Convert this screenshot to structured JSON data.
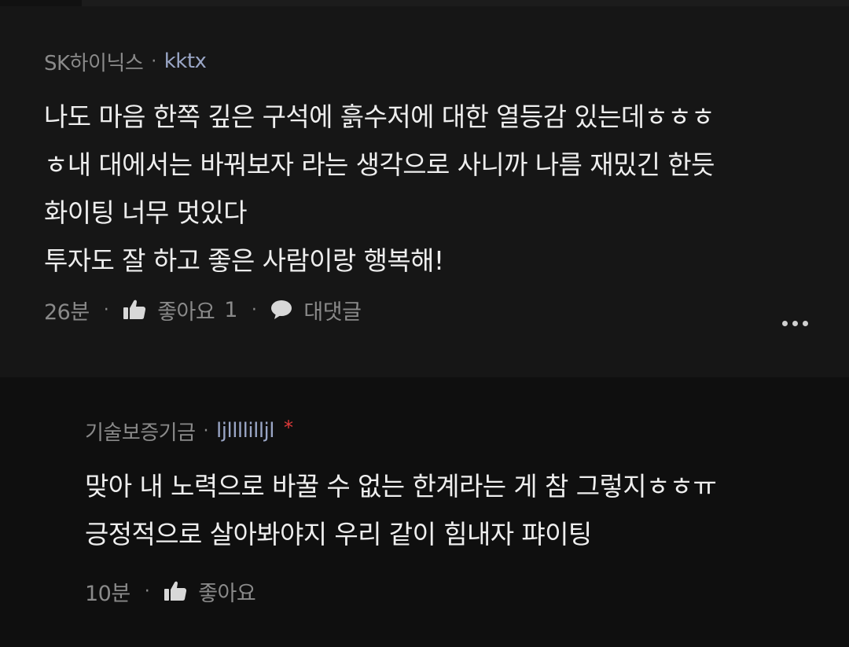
{
  "comments": [
    {
      "company": "SK하이닉스",
      "separator": "·",
      "author": "kktx",
      "lines": [
        "나도 마음 한쪽 깊은 구석에 흙수저에 대한 열등감 있는데ㅎㅎㅎ",
        "ㅎ내 대에서는 바꿔보자 라는 생각으로 사니까 나름 재밌긴 한듯",
        "화이팅 너무 멋있다",
        "투자도 잘 하고 좋은 사람이랑 행복해!"
      ],
      "time": "26분",
      "like_label": "좋아요",
      "like_count": "1",
      "reply_label": "대댓글",
      "more_icon": "more-icon"
    },
    {
      "company": "기술보증기금",
      "separator": "·",
      "author": "ljllllilljl",
      "author_mark": "*",
      "lines": [
        "맞아 내 노력으로 바꿀 수 없는 한계라는 게 참 그렇지ㅎㅎㅠ",
        "긍정적으로 살아봐야지 우리 같이 힘내자 퍄이팅"
      ],
      "time": "10분",
      "like_label": "좋아요"
    }
  ],
  "colors": {
    "background": "#0e0e0e",
    "comment_bg": "#161616",
    "author": "#9aa6c6",
    "meta": "#8a8a8a",
    "mark": "#e03b3b"
  }
}
